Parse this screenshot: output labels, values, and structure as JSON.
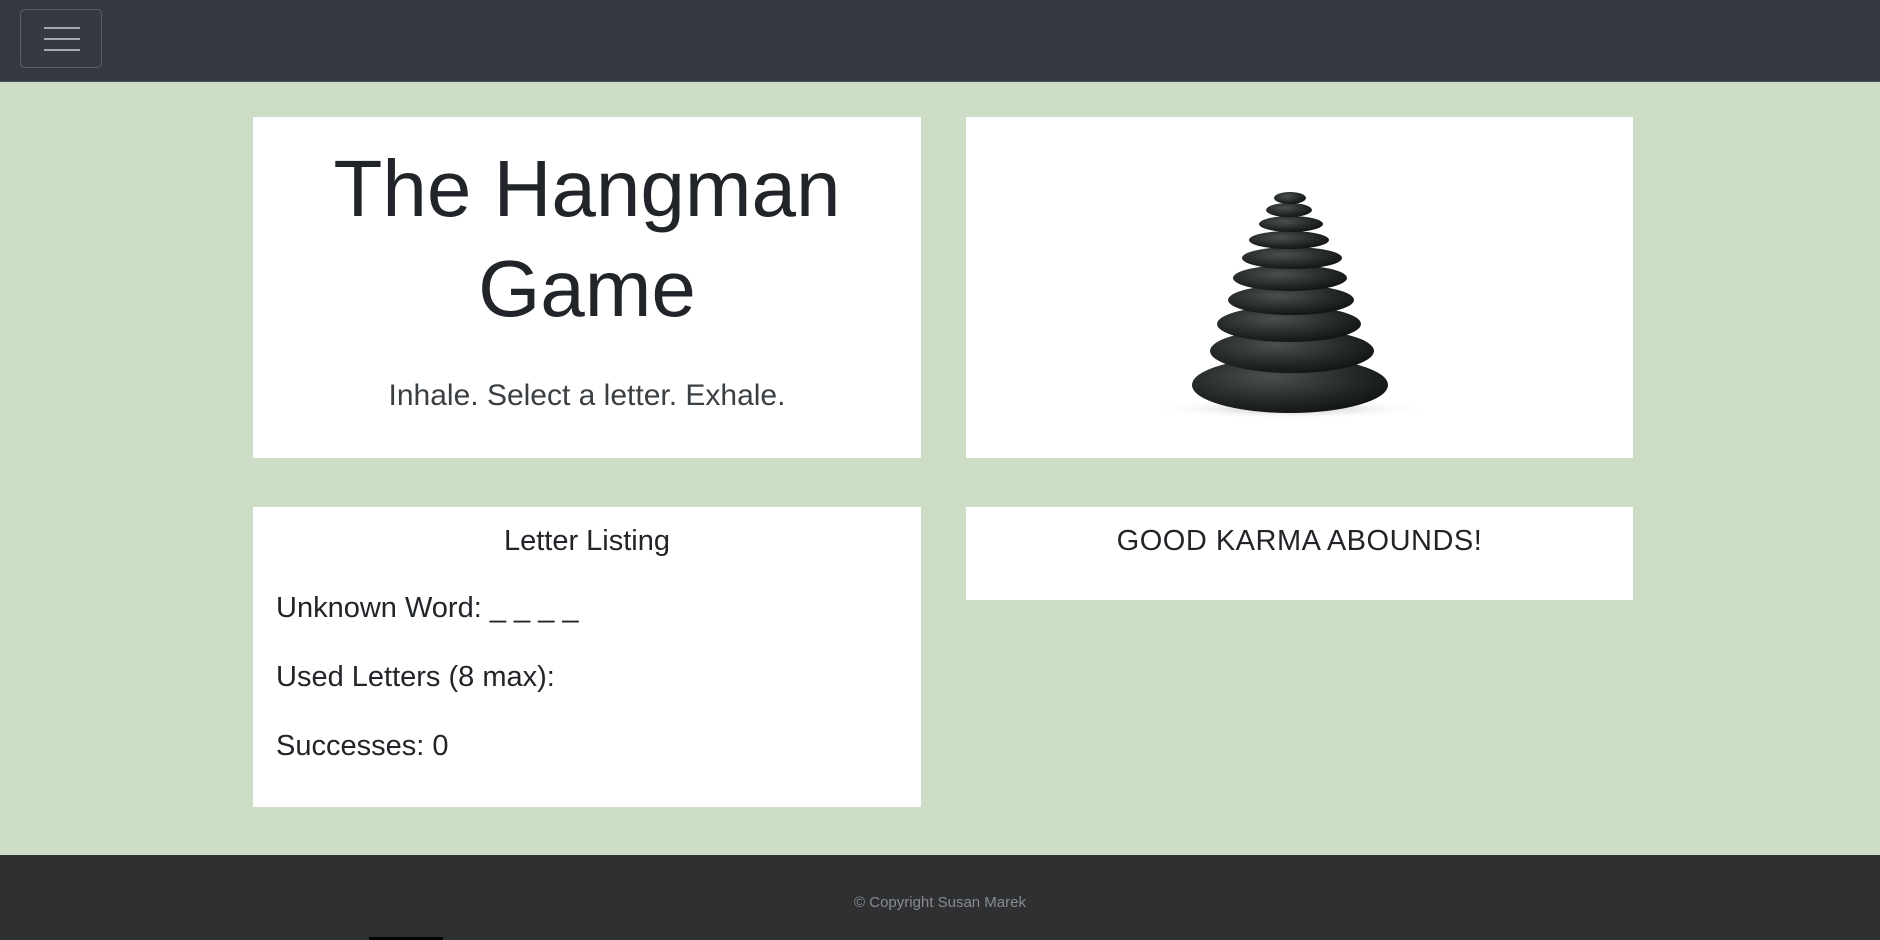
{
  "navbar": {
    "toggle_icon": "hamburger-menu-icon"
  },
  "hero": {
    "title_line1": "The Hangman",
    "title_line2": "Game",
    "subtitle": "Inhale. Select a letter. Exhale.",
    "image": "stacked-zen-stones"
  },
  "letters": {
    "heading": "Letter Listing",
    "unknown_word": "Unknown Word: _ _ _ _",
    "used_letters": "Used Letters (8 max):",
    "successes": "Successes: 0"
  },
  "karma": {
    "message": "GOOD KARMA ABOUNDS!"
  },
  "footer": {
    "copyright": "© Copyright Susan Marek"
  }
}
